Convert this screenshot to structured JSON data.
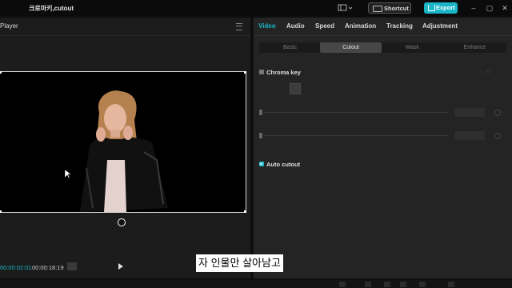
{
  "app": {
    "title": "크로마키,cutout"
  },
  "toolbar": {
    "shortcut_label": "Shortcut",
    "export_label": "Export"
  },
  "player": {
    "title": "Player",
    "time_current": "00:00:02:01",
    "time_total": "00:00:18:19"
  },
  "details": {
    "tabs": [
      "Video",
      "Audio",
      "Speed",
      "Animation",
      "Tracking",
      "Adjustment"
    ],
    "active_tab": "Video",
    "subtabs": [
      "Basic",
      "Cutout",
      "Mask",
      "Enhance"
    ],
    "active_subtab": "Cutout",
    "chroma_key": {
      "label": "Chroma key",
      "checked": false
    },
    "auto_cutout": {
      "label": "Auto cutout",
      "checked": true
    }
  },
  "subtitle": {
    "text": "자 인물만 살아남고"
  },
  "colors": {
    "accent": "#19b6c8",
    "panel": "#242424",
    "player_bg": "#1c1c1c"
  },
  "icons": [
    "layout-icon",
    "keyboard-icon",
    "export-icon",
    "minimize-icon",
    "maximize-icon",
    "close-icon",
    "menu-icon",
    "rotate-icon",
    "play-icon",
    "cursor-icon"
  ]
}
